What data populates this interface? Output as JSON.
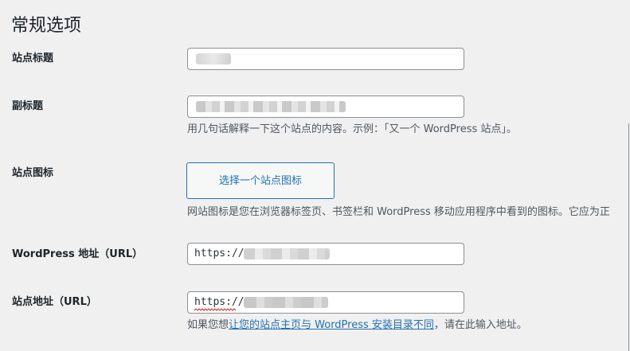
{
  "page": {
    "title": "常规选项"
  },
  "fields": {
    "site_title": {
      "label": "站点标题",
      "value": ""
    },
    "tagline": {
      "label": "副标题",
      "value": "",
      "description": "用几句话解释一下这个站点的内容。示例：「又一个 WordPress 站点」。"
    },
    "site_icon": {
      "label": "站点图标",
      "button_label": "选择一个站点图标",
      "description": "网站图标是您在浏览器标签页、书签栏和 WordPress 移动应用程序中看到的图标。它应为正"
    },
    "wordpress_address": {
      "label": "WordPress 地址（URL）",
      "value": "https://"
    },
    "site_address": {
      "label": "站点地址（URL）",
      "value": "https://",
      "description_prefix": "如果您想",
      "description_link": "让您的站点主页与 WordPress 安装目录不同",
      "description_suffix": "，请在此输入地址。"
    }
  },
  "colors": {
    "background": "#f0f0f1",
    "link": "#2271b1",
    "border": "#8c8f94",
    "text": "#1d2327",
    "description": "#50575e"
  }
}
